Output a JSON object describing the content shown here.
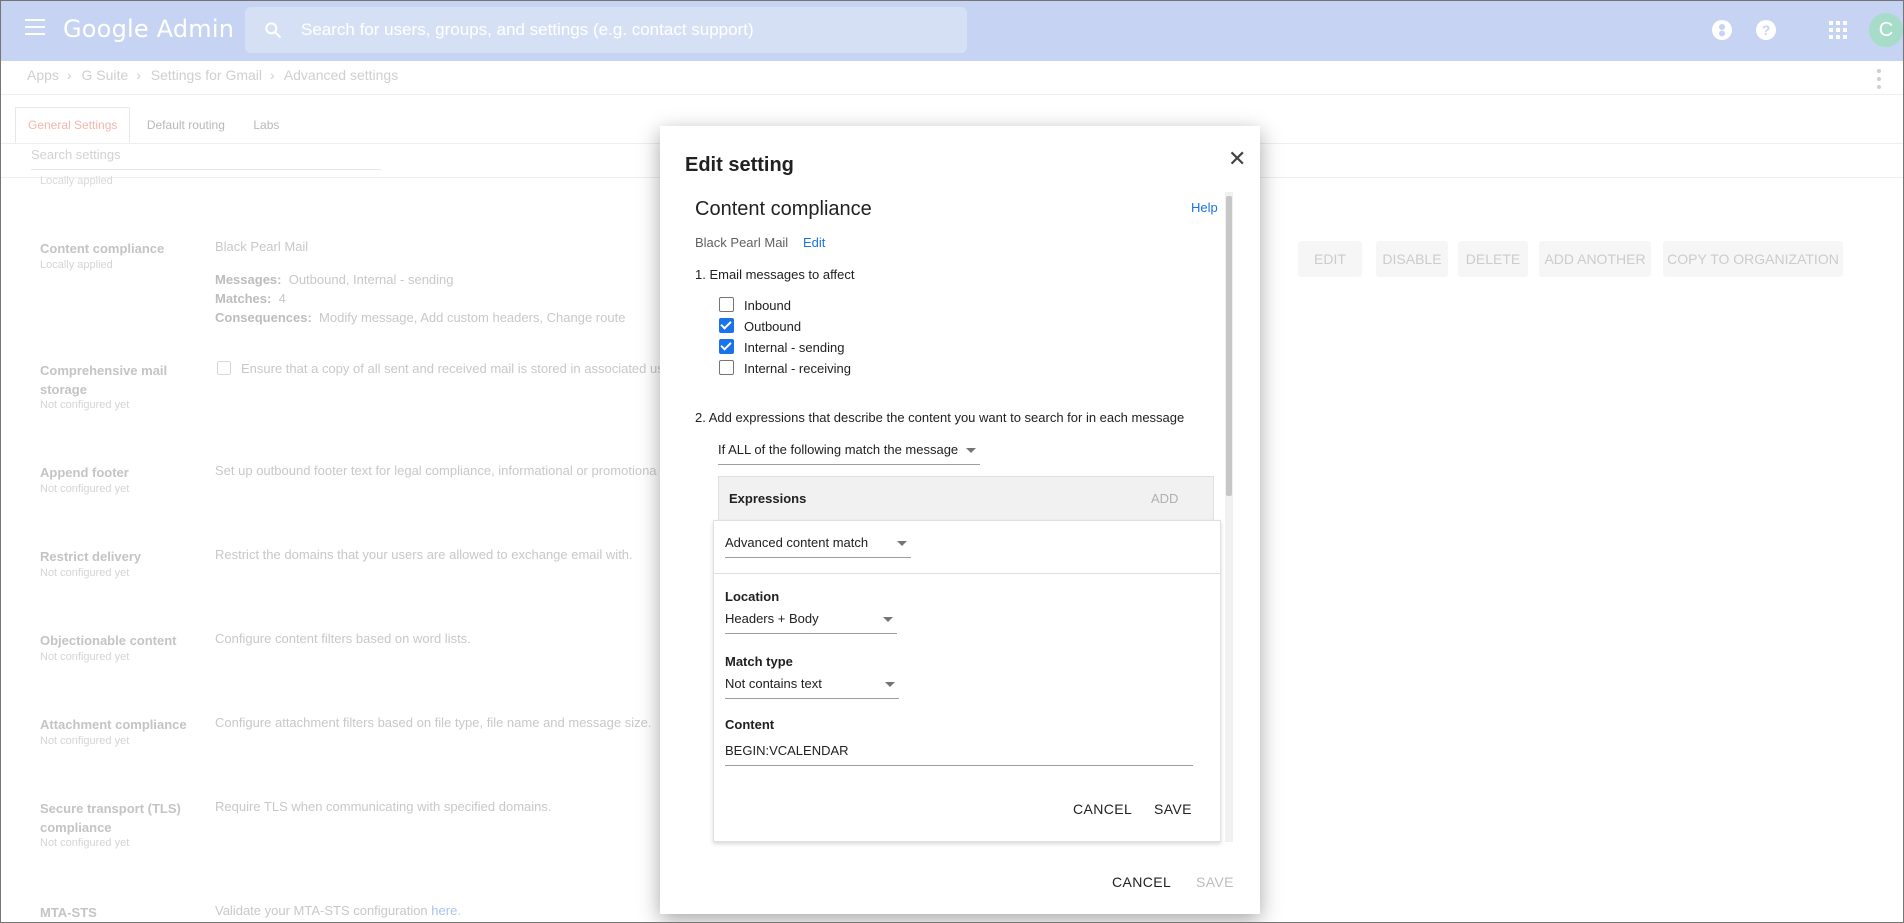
{
  "header": {
    "brand": "Google Admin",
    "search_placeholder": "Search for users, groups, and settings (e.g. contact support)",
    "avatar_letter": "C"
  },
  "breadcrumb": [
    "Apps",
    "G Suite",
    "Settings for Gmail",
    "Advanced settings"
  ],
  "tabs": [
    "General Settings",
    "Default routing",
    "Labs"
  ],
  "bg_search_placeholder": "Search settings",
  "locally_applied_top": "Locally applied",
  "settings_rows": [
    {
      "title": "Content compliance",
      "status": "Locally applied",
      "org": "Black Pearl Mail",
      "messages_label": "Messages:",
      "messages": "Outbound, Internal - sending",
      "matches_label": "Matches:",
      "matches": "4",
      "consequences_label": "Consequences:",
      "consequences": "Modify message, Add custom headers, Change route"
    },
    {
      "title": "Comprehensive mail storage",
      "status": "Not configured yet",
      "desc": "Ensure that a copy of all sent and received mail is stored in associated us"
    },
    {
      "title": "Append footer",
      "status": "Not configured yet",
      "desc": "Set up outbound footer text for legal compliance, informational or promotiona"
    },
    {
      "title": "Restrict delivery",
      "status": "Not configured yet",
      "desc": "Restrict the domains that your users are allowed to exchange email with."
    },
    {
      "title": "Objectionable content",
      "status": "Not configured yet",
      "desc": "Configure content filters based on word lists."
    },
    {
      "title": "Attachment compliance",
      "status": "Not configured yet",
      "desc": "Configure attachment filters based on file type, file name and message size."
    },
    {
      "title": "Secure transport (TLS) compliance",
      "status": "Not configured yet",
      "desc": "Require TLS when communicating with specified domains."
    },
    {
      "title": "MTA-STS",
      "desc": "Validate your MTA-STS configuration",
      "link": "here",
      "desc_end": "."
    }
  ],
  "row_actions": [
    "EDIT",
    "DISABLE",
    "DELETE",
    "ADD ANOTHER",
    "COPY TO ORGANIZATION"
  ],
  "dialog": {
    "title": "Edit setting",
    "section_title": "Content compliance",
    "help": "Help",
    "org": "Black Pearl Mail",
    "edit": "Edit",
    "step1": "1. Email messages to affect",
    "message_types": [
      {
        "label": "Inbound",
        "checked": false
      },
      {
        "label": "Outbound",
        "checked": true
      },
      {
        "label": "Internal - sending",
        "checked": true
      },
      {
        "label": "Internal - receiving",
        "checked": false
      }
    ],
    "step2": "2. Add expressions that describe the content you want to search for in each message",
    "match_mode": "If ALL of the following match the message",
    "expressions_label": "Expressions",
    "add_label": "ADD",
    "expression": {
      "type": "Advanced content match",
      "location_label": "Location",
      "location": "Headers + Body",
      "match_type_label": "Match type",
      "match_type": "Not contains text",
      "content_label": "Content",
      "content": "BEGIN:VCALENDAR",
      "cancel": "CANCEL",
      "save": "SAVE"
    },
    "cancel": "CANCEL",
    "save": "SAVE"
  },
  "colors": {
    "topbar": "#c6d3f2",
    "accent": "#1a73e8",
    "disabled": "#bdbdbd"
  }
}
